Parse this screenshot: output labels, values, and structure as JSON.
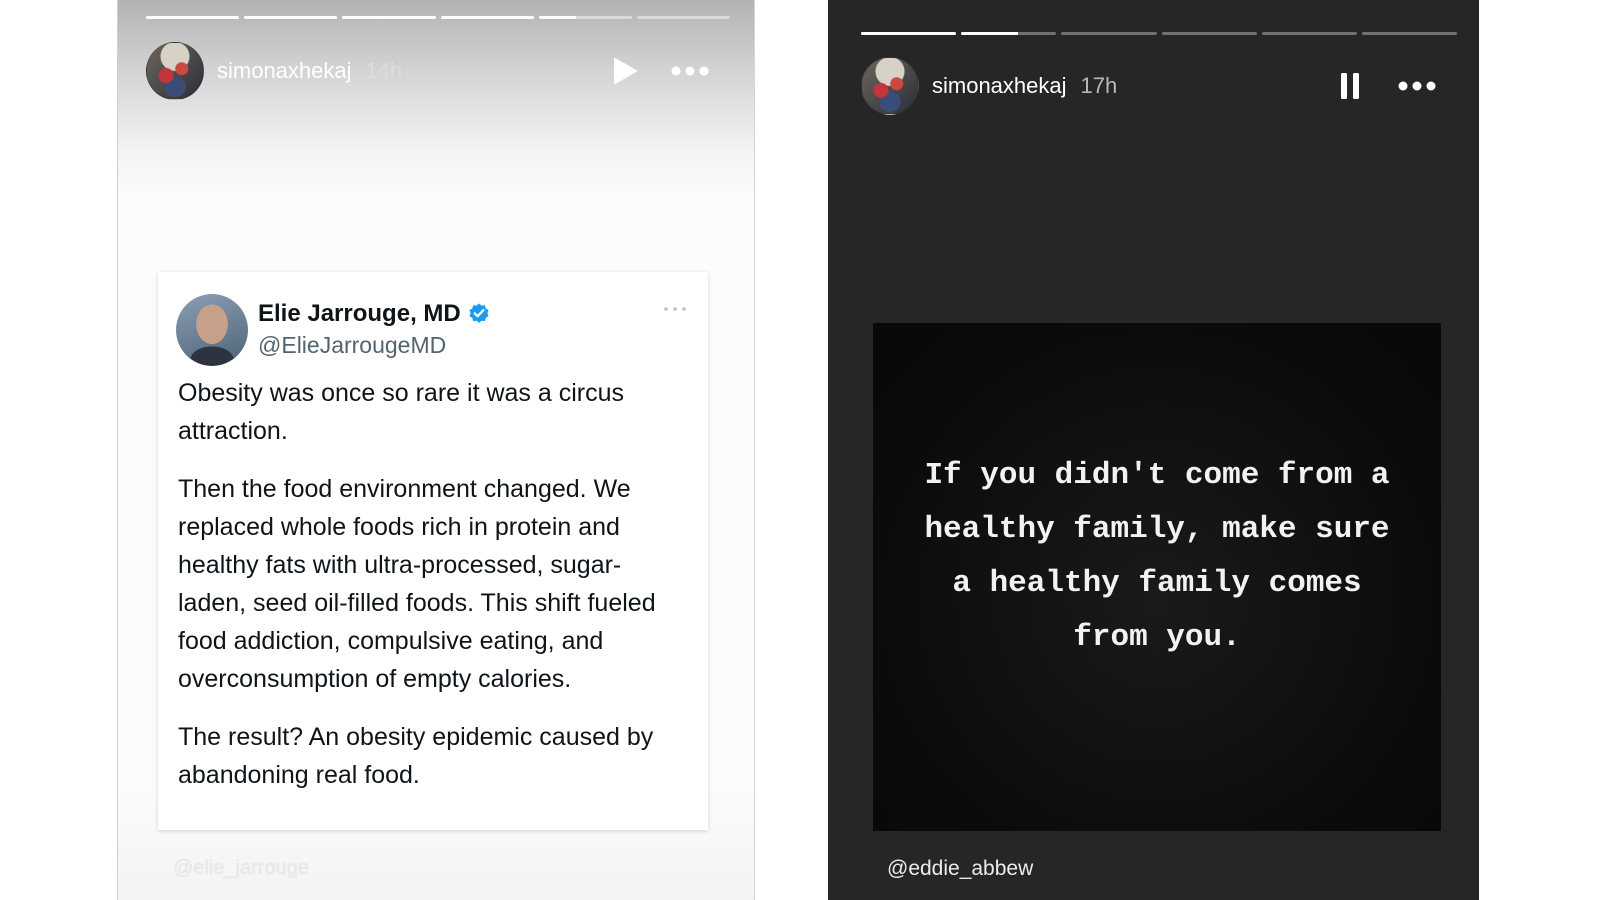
{
  "story_left": {
    "progress": [
      1,
      1,
      1,
      1,
      0.4,
      0
    ],
    "username": "simonaxhekaj",
    "timestamp": "14h",
    "controls": {
      "play_icon": "play-icon",
      "more_icon": "more-horizontal-icon"
    },
    "tweet": {
      "name": "Elie Jarrouge, MD",
      "handle": "@ElieJarrougeMD",
      "verified_color": "#1d9bf0",
      "paragraphs": [
        "Obesity was once so rare it was a circus attraction.",
        "Then the food environment changed. We replaced whole foods rich in protein and healthy fats with ultra-processed, sugar-laden, seed oil-filled foods. This shift fueled food addiction, compulsive eating, and overconsumption of empty calories.",
        "The result? An obesity epidemic caused by abandoning real food."
      ]
    },
    "watermark": "@elie_jarrouge"
  },
  "story_right": {
    "progress": [
      1,
      0.6,
      0,
      0,
      0,
      0
    ],
    "username": "simonaxhekaj",
    "timestamp": "17h",
    "controls": {
      "pause_icon": "pause-icon",
      "more_icon": "more-horizontal-icon"
    },
    "quote": "If you didn't come from a healthy family, make sure a healthy family comes from you.",
    "credit": "@eddie_abbew"
  }
}
